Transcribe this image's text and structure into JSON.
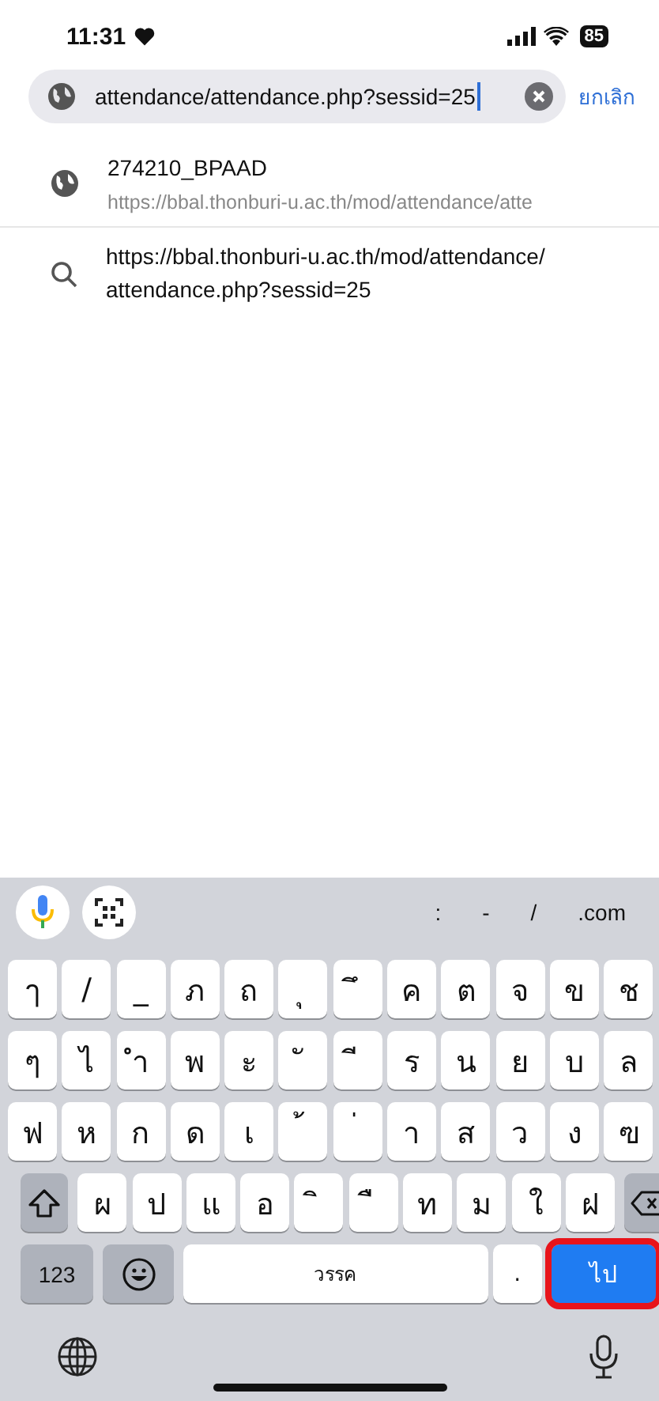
{
  "status_bar": {
    "time": "11:31",
    "battery": "85"
  },
  "address_bar": {
    "value": "attendance/attendance.php?sessid=25",
    "cancel": "ยกเลิก"
  },
  "suggestions": [
    {
      "kind": "site",
      "title": "274210_BPAAD",
      "url": "https://bbal.thonburi-u.ac.th/mod/attendance/atte"
    },
    {
      "kind": "search",
      "title": "https://bbal.thonburi-u.ac.th/mod/attendance/ attendance.php?sessid=25"
    }
  ],
  "keyboard": {
    "shortcuts": [
      ":",
      "-",
      "/",
      ".com"
    ],
    "rows": [
      [
        {
          "kind": "char",
          "label": "ๅ"
        },
        {
          "kind": "char",
          "label": "/"
        },
        {
          "kind": "char",
          "label": "_"
        },
        {
          "kind": "char",
          "label": "ภ"
        },
        {
          "kind": "char",
          "label": "ถ"
        },
        {
          "kind": "char",
          "label": "ุ"
        },
        {
          "kind": "char",
          "label": "ึ"
        },
        {
          "kind": "char",
          "label": "ค"
        },
        {
          "kind": "char",
          "label": "ต"
        },
        {
          "kind": "char",
          "label": "จ"
        },
        {
          "kind": "char",
          "label": "ข"
        },
        {
          "kind": "char",
          "label": "ช"
        }
      ],
      [
        {
          "kind": "char",
          "label": "ๆ"
        },
        {
          "kind": "char",
          "label": "ไ"
        },
        {
          "kind": "char",
          "label": "ำ"
        },
        {
          "kind": "char",
          "label": "พ"
        },
        {
          "kind": "char",
          "label": "ะ"
        },
        {
          "kind": "char",
          "label": "ั"
        },
        {
          "kind": "char",
          "label": "ี"
        },
        {
          "kind": "char",
          "label": "ร"
        },
        {
          "kind": "char",
          "label": "น"
        },
        {
          "kind": "char",
          "label": "ย"
        },
        {
          "kind": "char",
          "label": "บ"
        },
        {
          "kind": "char",
          "label": "ล"
        }
      ],
      [
        {
          "kind": "char",
          "label": "ฟ"
        },
        {
          "kind": "char",
          "label": "ห"
        },
        {
          "kind": "char",
          "label": "ก"
        },
        {
          "kind": "char",
          "label": "ด"
        },
        {
          "kind": "char",
          "label": "เ"
        },
        {
          "kind": "char",
          "label": "้"
        },
        {
          "kind": "char",
          "label": "่"
        },
        {
          "kind": "char",
          "label": "า"
        },
        {
          "kind": "char",
          "label": "ส"
        },
        {
          "kind": "char",
          "label": "ว"
        },
        {
          "kind": "char",
          "label": "ง"
        },
        {
          "kind": "char",
          "label": "ฃ"
        }
      ],
      [
        {
          "kind": "shift"
        },
        {
          "kind": "char",
          "label": "ผ"
        },
        {
          "kind": "char",
          "label": "ป"
        },
        {
          "kind": "char",
          "label": "แ"
        },
        {
          "kind": "char",
          "label": "อ"
        },
        {
          "kind": "char",
          "label": "ิ"
        },
        {
          "kind": "char",
          "label": "ื"
        },
        {
          "kind": "char",
          "label": "ท"
        },
        {
          "kind": "char",
          "label": "ม"
        },
        {
          "kind": "char",
          "label": "ใ"
        },
        {
          "kind": "char",
          "label": "ฝ"
        },
        {
          "kind": "backspace"
        }
      ]
    ],
    "bottom_row": {
      "numbers_key": "123",
      "space_key": "วรรค",
      "period_key": ".",
      "go_key": {
        "label": "ไป",
        "highlighted": true
      }
    }
  }
}
